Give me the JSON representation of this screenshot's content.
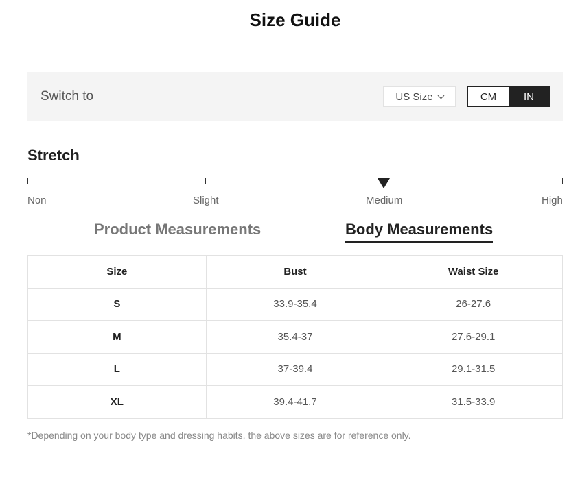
{
  "title": "Size Guide",
  "switch": {
    "label": "Switch to",
    "size_system": "US Size",
    "units": {
      "cm": "CM",
      "in": "IN",
      "selected": "IN"
    }
  },
  "stretch": {
    "title": "Stretch",
    "levels": [
      "Non",
      "Slight",
      "Medium",
      "High"
    ],
    "selected": "Medium"
  },
  "tabs": {
    "product": "Product Measurements",
    "body": "Body Measurements",
    "active": "Body Measurements"
  },
  "table": {
    "headers": [
      "Size",
      "Bust",
      "Waist Size"
    ],
    "rows": [
      [
        "S",
        "33.9-35.4",
        "26-27.6"
      ],
      [
        "M",
        "35.4-37",
        "27.6-29.1"
      ],
      [
        "L",
        "37-39.4",
        "29.1-31.5"
      ],
      [
        "XL",
        "39.4-41.7",
        "31.5-33.9"
      ]
    ]
  },
  "footnote": "*Depending on your body type and dressing habits, the above sizes are for reference only.",
  "colors": {
    "accent": "#222222",
    "panel": "#f4f4f4",
    "border": "#e2e2e2"
  }
}
